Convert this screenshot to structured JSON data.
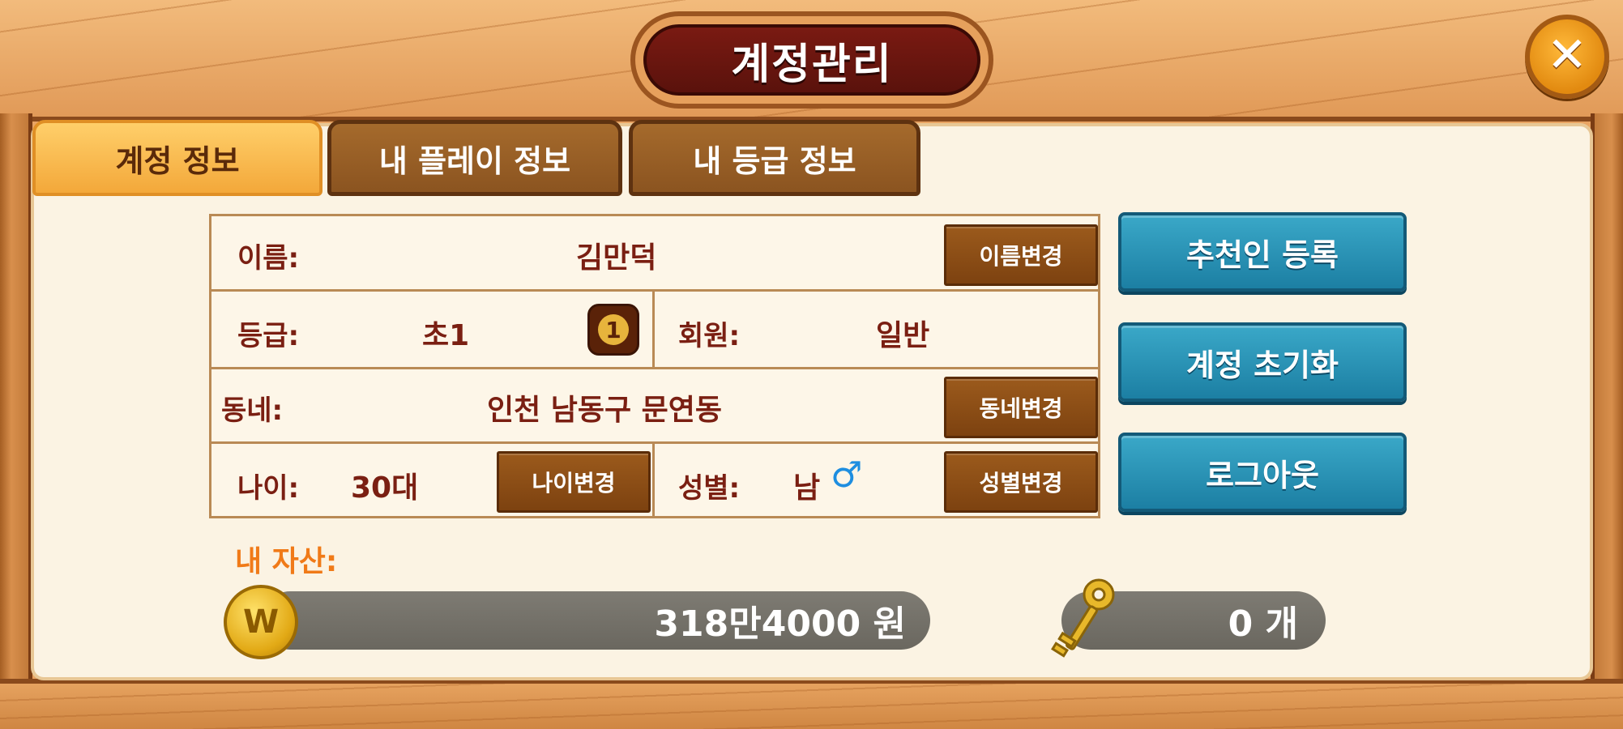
{
  "title": "계정관리",
  "close_icon": "close-icon",
  "tabs": [
    {
      "label": "계정 정보",
      "active": true
    },
    {
      "label": "내 플레이 정보",
      "active": false
    },
    {
      "label": "내 등급 정보",
      "active": false
    }
  ],
  "info": {
    "name_label": "이름:",
    "name_value": "김만덕",
    "name_change": "이름변경",
    "grade_label": "등급:",
    "grade_value": "초1",
    "grade_badge": "1",
    "member_label": "회원:",
    "member_value": "일반",
    "town_label": "동네:",
    "town_value": "인천 남동구 문연동",
    "town_change": "동네변경",
    "age_label": "나이:",
    "age_value": "30대",
    "age_change": "나이변경",
    "gender_label": "성별:",
    "gender_value": "남",
    "gender_symbol": "♂",
    "gender_change": "성별변경"
  },
  "actions": {
    "referrer": "추천인 등록",
    "reset": "계정 초기화",
    "logout": "로그아웃"
  },
  "assets": {
    "label": "내 자산:",
    "coin_symbol": "W",
    "coin_amount": "318만4000 원",
    "key_amount": "0 개"
  },
  "colors": {
    "accent_blue": "#1c7fa3",
    "title_red": "#5a120c",
    "assets_orange": "#f07a18",
    "text_brown": "#7a1f12"
  }
}
